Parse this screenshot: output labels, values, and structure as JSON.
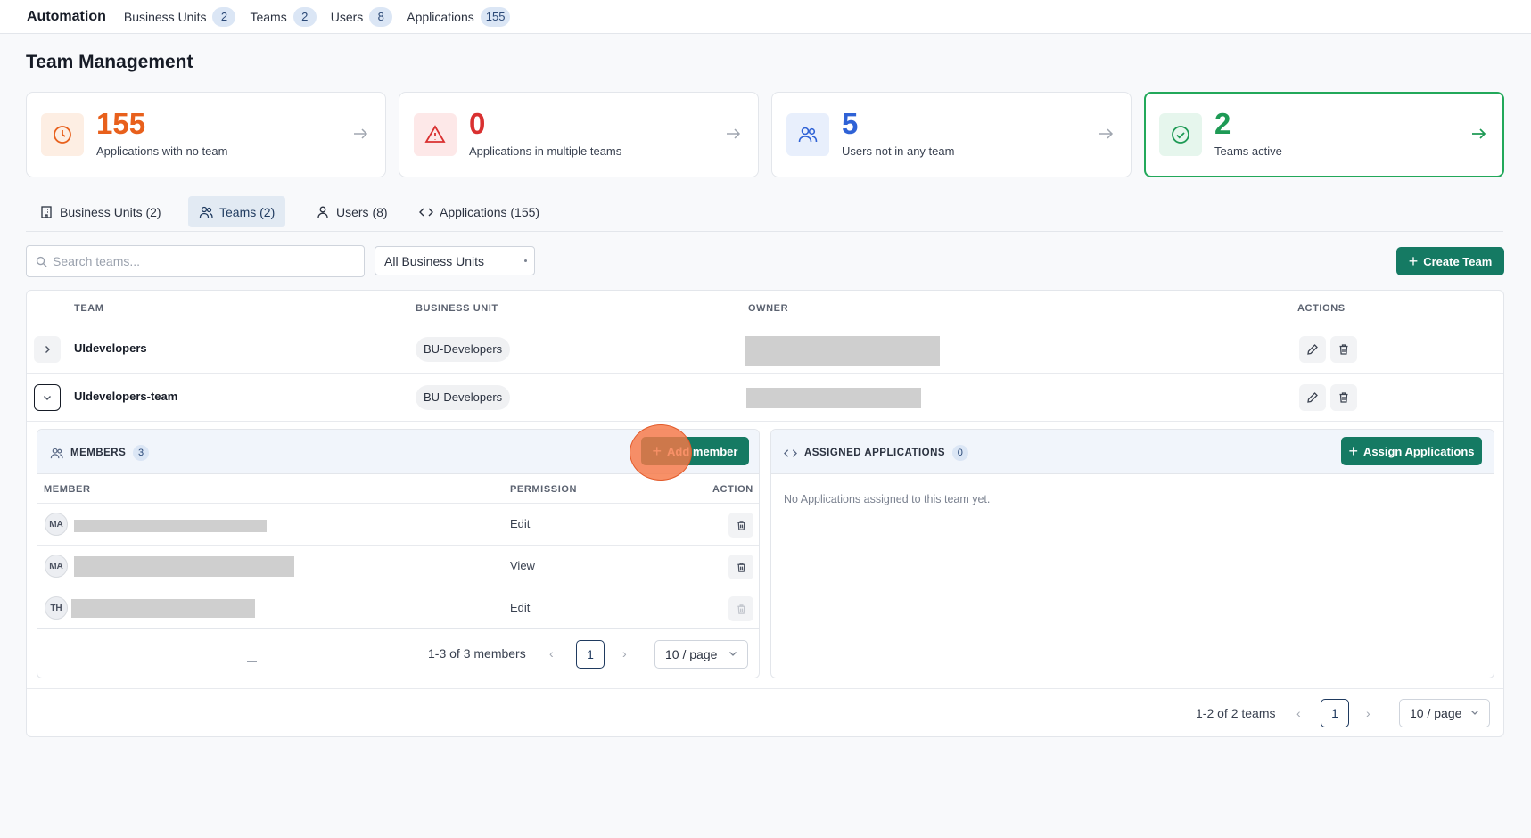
{
  "topbar": {
    "brand": "Automation",
    "nav": [
      {
        "label": "Business Units",
        "count": "2"
      },
      {
        "label": "Teams",
        "count": "2"
      },
      {
        "label": "Users",
        "count": "8"
      },
      {
        "label": "Applications",
        "count": "155"
      }
    ]
  },
  "page_title": "Team Management",
  "stats": [
    {
      "value": "155",
      "label": "Applications with no team",
      "icon": "clock-icon",
      "color": "#e8601c"
    },
    {
      "value": "0",
      "label": "Applications in multiple teams",
      "icon": "warning-icon",
      "color": "#d93030"
    },
    {
      "value": "5",
      "label": "Users not in any team",
      "icon": "users-icon",
      "color": "#2f62d6"
    },
    {
      "value": "2",
      "label": "Teams active",
      "icon": "check-circle-icon",
      "color": "#1e9a55"
    }
  ],
  "tabs": [
    {
      "label": "Business Units (2)",
      "icon": "building-icon"
    },
    {
      "label": "Teams (2)",
      "icon": "users-icon"
    },
    {
      "label": "Users (8)",
      "icon": "user-icon"
    },
    {
      "label": "Applications (155)",
      "icon": "code-icon"
    }
  ],
  "toolbar": {
    "search_placeholder": "Search teams...",
    "bu_filter": "All Business Units",
    "create_label": "Create Team"
  },
  "table": {
    "headers": {
      "team": "TEAM",
      "business_unit": "BUSINESS UNIT",
      "owner": "OWNER",
      "actions": "ACTIONS"
    },
    "rows": [
      {
        "team": "UIdevelopers",
        "business_unit": "BU-Developers",
        "expanded": false
      },
      {
        "team": "UIdevelopers-team",
        "business_unit": "BU-Developers",
        "expanded": true
      }
    ]
  },
  "members": {
    "title": "MEMBERS",
    "count": "3",
    "add_label": "Add member",
    "headers": {
      "member": "MEMBER",
      "permission": "PERMISSION",
      "action": "ACTION"
    },
    "rows": [
      {
        "initials": "MA",
        "permission": "Edit"
      },
      {
        "initials": "MA",
        "permission": "View"
      },
      {
        "initials": "TH",
        "permission": "Edit"
      }
    ],
    "pager": {
      "summary": "1-3 of 3 members",
      "page": "1",
      "page_size": "10 / page"
    }
  },
  "applications": {
    "title": "ASSIGNED APPLICATIONS",
    "count": "0",
    "assign_label": "Assign Applications",
    "empty": "No Applications assigned to this team yet."
  },
  "footer_pager": {
    "summary": "1-2 of 2 teams",
    "page": "1",
    "page_size": "10 / page"
  }
}
